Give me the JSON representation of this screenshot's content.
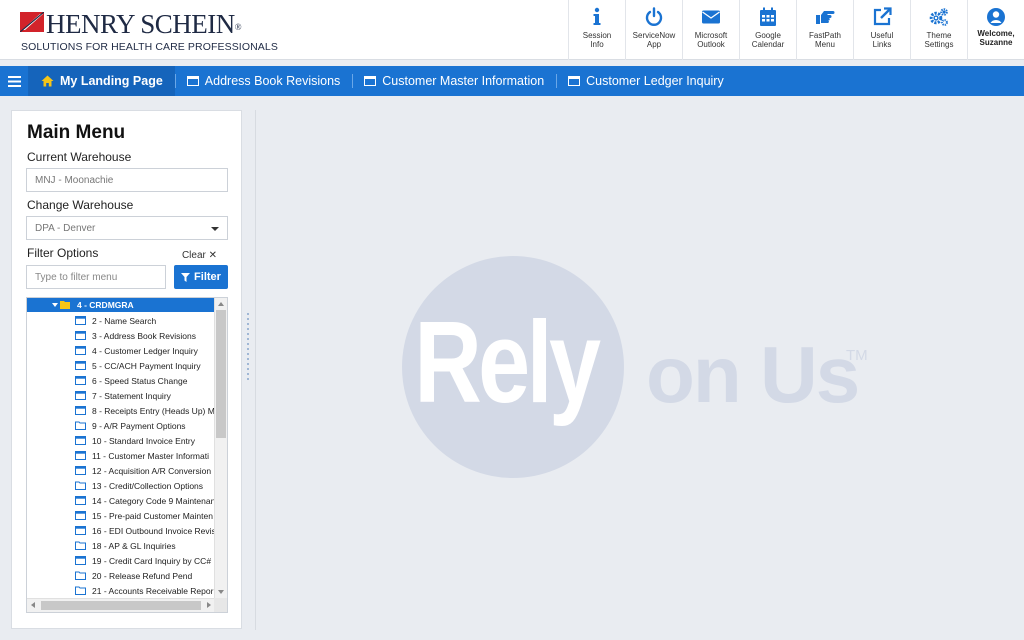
{
  "brand": {
    "name": "HENRY SCHEIN",
    "registered_mark": "®",
    "tagline": "SOLUTIONS FOR HEALTH CARE PROFESSIONALS"
  },
  "toolbar": [
    {
      "label_1": "Session",
      "label_2": "Info",
      "icon": "info-icon"
    },
    {
      "label_1": "ServiceNow",
      "label_2": "App",
      "icon": "power-icon"
    },
    {
      "label_1": "Microsoft",
      "label_2": "Outlook",
      "icon": "envelope-icon"
    },
    {
      "label_1": "Google",
      "label_2": "Calendar",
      "icon": "calendar-icon"
    },
    {
      "label_1": "FastPath",
      "label_2": "Menu",
      "icon": "hand-pointer-icon"
    },
    {
      "label_1": "Useful",
      "label_2": "Links",
      "icon": "external-link-icon"
    },
    {
      "label_1": "Theme",
      "label_2": "Settings",
      "icon": "gears-icon"
    },
    {
      "label_1": "Welcome,",
      "label_2": "Suzanne",
      "icon": "user-circle-icon"
    }
  ],
  "tabs": [
    {
      "label": "My Landing Page",
      "active": true,
      "icon": "home-icon"
    },
    {
      "label": "Address Book Revisions",
      "active": false,
      "icon": "window-icon"
    },
    {
      "label": "Customer Master Information",
      "active": false,
      "icon": "window-icon"
    },
    {
      "label": "Customer Ledger Inquiry",
      "active": false,
      "icon": "window-icon"
    }
  ],
  "main_menu": {
    "title": "Main Menu",
    "current_warehouse_label": "Current Warehouse",
    "current_warehouse_value": "MNJ - Moonachie",
    "change_warehouse_label": "Change Warehouse",
    "change_warehouse_value": "DPA - Denver",
    "filter_options_label": "Filter Options",
    "clear_label": "Clear ✕",
    "filter_placeholder": "Type to filter menu",
    "filter_button": "Filter",
    "tree_root": "4 - CRDMGRA",
    "tree_items": [
      {
        "label": "2 - Name Search",
        "type": "window"
      },
      {
        "label": "3 - Address Book Revisions",
        "type": "window"
      },
      {
        "label": "4 - Customer Ledger Inquiry",
        "type": "window"
      },
      {
        "label": "5 - CC/ACH Payment Inquiry",
        "type": "window"
      },
      {
        "label": "6 - Speed Status Change",
        "type": "window"
      },
      {
        "label": "7 - Statement Inquiry",
        "type": "window"
      },
      {
        "label": "8 - Receipts Entry (Heads Up) M",
        "type": "window"
      },
      {
        "label": "9 - A/R Payment Options",
        "type": "folder"
      },
      {
        "label": "10 - Standard Invoice Entry",
        "type": "window"
      },
      {
        "label": "11 - Customer Master Informati",
        "type": "window"
      },
      {
        "label": "12 - Acquisition A/R Conversion",
        "type": "window"
      },
      {
        "label": "13 - Credit/Collection Options",
        "type": "folder"
      },
      {
        "label": "14 - Category Code 9 Maintenan",
        "type": "window"
      },
      {
        "label": "15 - Pre-paid Customer Mainten",
        "type": "window"
      },
      {
        "label": "16 - EDI Outbound Invoice Revis",
        "type": "window"
      },
      {
        "label": "18 - AP & GL Inquiries",
        "type": "folder"
      },
      {
        "label": "19 - Credit Card Inquiry by CC#",
        "type": "window"
      },
      {
        "label": "20 - Release Refund Pend",
        "type": "folder"
      },
      {
        "label": "21 - Accounts Receivable Repor",
        "type": "folder"
      }
    ]
  },
  "watermark": {
    "word_1": "Rely",
    "word_2": "on Us",
    "trademark": "TM"
  },
  "colors": {
    "accent": "#1a73d2",
    "brand_red": "#d2232a",
    "watermark": "#d3d9e6"
  }
}
